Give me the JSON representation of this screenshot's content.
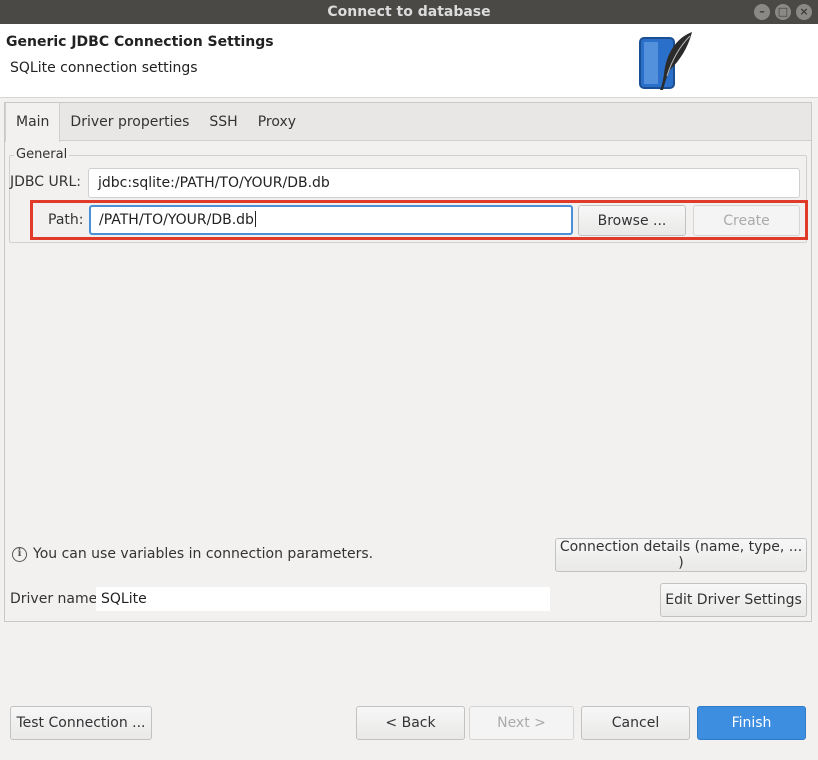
{
  "window": {
    "title": "Connect to database",
    "controls": [
      "minimize-icon",
      "maximize-icon",
      "close-icon"
    ]
  },
  "header": {
    "title": "Generic JDBC Connection Settings",
    "subtitle": "SQLite connection settings",
    "logo_icon": "sqlite-feather-logo"
  },
  "tabs": [
    {
      "label": "Main",
      "active": true
    },
    {
      "label": "Driver properties",
      "active": false
    },
    {
      "label": "SSH",
      "active": false
    },
    {
      "label": "Proxy",
      "active": false
    }
  ],
  "general": {
    "group_label": "General",
    "jdbc_url_label": "JDBC URL:",
    "jdbc_url_value": "jdbc:sqlite:/PATH/TO/YOUR/DB.db",
    "path_label": "Path:",
    "path_value": "/PATH/TO/YOUR/DB.db",
    "browse_label": "Browse ...",
    "create_label": "Create"
  },
  "info": {
    "icon": "info-icon",
    "text": "You can use variables in connection parameters.",
    "details_button": "Connection details (name, type, ... )"
  },
  "driver": {
    "label": "Driver name:",
    "value": "SQLite",
    "edit_button": "Edit Driver Settings"
  },
  "footer": {
    "test_connection": "Test Connection ...",
    "back": "< Back",
    "next": "Next >",
    "cancel": "Cancel",
    "finish": "Finish"
  },
  "colors": {
    "highlight_border": "#e03a2a",
    "primary_button": "#3d8ee0",
    "focus_border": "#4a90d9"
  }
}
